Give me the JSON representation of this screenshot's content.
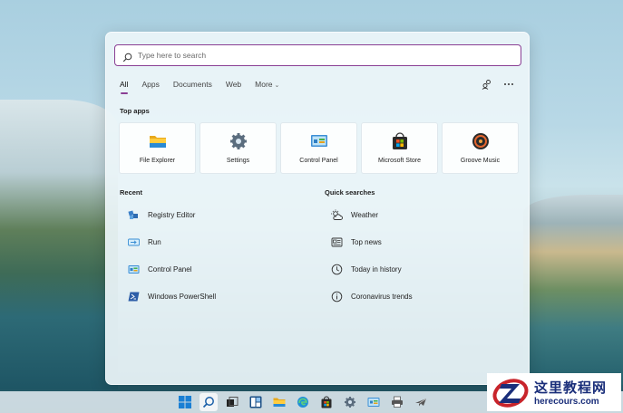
{
  "search": {
    "placeholder": "Type here to search"
  },
  "tabs": [
    {
      "label": "All",
      "active": true
    },
    {
      "label": "Apps"
    },
    {
      "label": "Documents"
    },
    {
      "label": "Web"
    },
    {
      "label": "More"
    }
  ],
  "top_apps": {
    "title": "Top apps",
    "items": [
      {
        "label": "File Explorer",
        "icon": "folder-icon"
      },
      {
        "label": "Settings",
        "icon": "gear-icon"
      },
      {
        "label": "Control Panel",
        "icon": "control-panel-icon"
      },
      {
        "label": "Microsoft Store",
        "icon": "store-icon"
      },
      {
        "label": "Groove Music",
        "icon": "groove-music-icon"
      }
    ]
  },
  "recent": {
    "title": "Recent",
    "items": [
      {
        "label": "Registry Editor",
        "icon": "registry-icon"
      },
      {
        "label": "Run",
        "icon": "run-icon"
      },
      {
        "label": "Control Panel",
        "icon": "control-panel-icon"
      },
      {
        "label": "Windows PowerShell",
        "icon": "powershell-icon"
      }
    ]
  },
  "quick_searches": {
    "title": "Quick searches",
    "items": [
      {
        "label": "Weather",
        "icon": "weather-icon"
      },
      {
        "label": "Top news",
        "icon": "news-icon"
      },
      {
        "label": "Today in history",
        "icon": "clock-icon"
      },
      {
        "label": "Coronavirus trends",
        "icon": "info-icon"
      }
    ]
  },
  "taskbar": {
    "items": [
      "windows-icon",
      "search-icon",
      "task-view-icon",
      "widgets-icon",
      "file-explorer-icon",
      "edge-icon",
      "store-icon",
      "settings-icon",
      "control-panel-icon",
      "printer-icon",
      "plane-icon"
    ]
  },
  "watermark": {
    "cn": "这里教程网",
    "en": "herecours.com"
  },
  "colors": {
    "accent": "#8a3f94",
    "panel": "#ecf5f9"
  }
}
